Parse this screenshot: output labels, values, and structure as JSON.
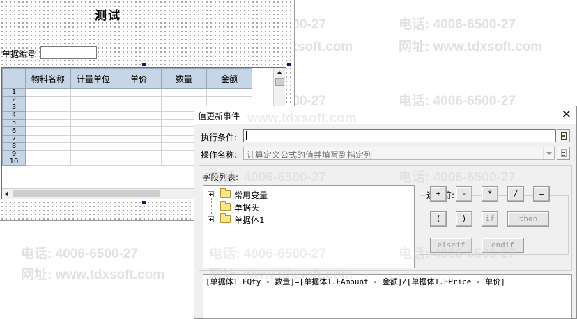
{
  "form": {
    "title": "测试",
    "doc_no_label": "单据编号",
    "doc_no_value": "",
    "grid": {
      "columns": [
        "物料名称",
        "计量单位",
        "单价",
        "数量",
        "金额"
      ],
      "row_numbers": [
        "1",
        "2",
        "3",
        "4",
        "5",
        "6",
        "7",
        "8",
        "9",
        "10"
      ]
    }
  },
  "watermark": {
    "phone": "电话: 4006-6500-27",
    "site": "网址: www.tdxsoft.com",
    "phone_short": "电话: 4006-6500-27",
    "site_partial_1": "www.tdxsoft.com",
    "site_partial_2": "网址: www.tdxsoft.com"
  },
  "dialog": {
    "title": "值更新事件",
    "close_symbol": "✕",
    "condition_label": "执行条件:",
    "condition_value": "",
    "operation_label": "操作名称:",
    "operation_value": "计算定义公式的值并填写到指定列",
    "field_list_label": "字段列表:",
    "tree": [
      {
        "label": "常用变量",
        "expandable": true
      },
      {
        "label": "单据头",
        "expandable": false
      },
      {
        "label": "单据体1",
        "expandable": true
      }
    ],
    "operators_label": "运算符:",
    "operators": {
      "row1": [
        "+",
        "-",
        "*",
        "/",
        "="
      ],
      "row2": [
        "(",
        ")",
        "if",
        "then"
      ],
      "row3": [
        "elseif",
        "endif"
      ]
    },
    "expression": "[单据体1.FQty - 数量]=[单据体1.FAmount - 金额]/[单据体1.FPrice - 单价]"
  }
}
